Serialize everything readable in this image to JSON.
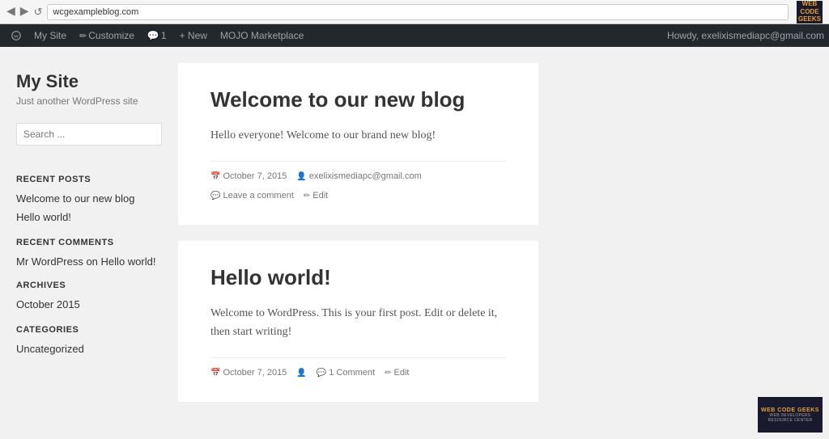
{
  "browser": {
    "url": "wcgexampleblog.com",
    "back_icon": "◀",
    "fwd_icon": "▶",
    "reload_icon": "↺"
  },
  "adminbar": {
    "wp_label": "WordPress",
    "my_site": "My Site",
    "customize": "Customize",
    "comment_count": "1",
    "new": "+ New",
    "mojo": "MOJO Marketplace",
    "howdy": "Howdy, exelixismediapc@gmail.com"
  },
  "sidebar": {
    "site_title": "My Site",
    "site_tagline": "Just another WordPress site",
    "search_placeholder": "Search ...",
    "recent_posts_title": "RECENT POSTS",
    "recent_posts": [
      {
        "label": "Welcome to our new blog",
        "href": "#"
      },
      {
        "label": "Hello world!",
        "href": "#"
      }
    ],
    "recent_comments_title": "RECENT COMMENTS",
    "recent_comments": [
      {
        "author": "Mr WordPress",
        "text": "on",
        "post": "Hello world!",
        "href": "#"
      }
    ],
    "archives_title": "ARCHIVES",
    "archives": [
      {
        "label": "October 2015",
        "href": "#"
      }
    ],
    "categories_title": "CATEGORIES",
    "categories": [
      {
        "label": "Uncategorized",
        "href": "#"
      }
    ]
  },
  "posts": [
    {
      "title": "Welcome to our new blog",
      "content": "Hello everyone! Welcome to our brand new blog!",
      "date": "October 7, 2015",
      "author": "exelixismediapc@gmail.com",
      "comment_link": "Leave a comment",
      "edit_link": "Edit"
    },
    {
      "title": "Hello world!",
      "content": "Welcome to WordPress. This is your first post. Edit or delete it, then start writing!",
      "date": "October 7, 2015",
      "author": "",
      "comment_link": "1 Comment",
      "edit_link": "Edit"
    }
  ],
  "wcg": {
    "logo_text": "WEB CODE GEEKS",
    "logo_sub": "WEB DEVELOPERS RESOURCE CENTER"
  }
}
